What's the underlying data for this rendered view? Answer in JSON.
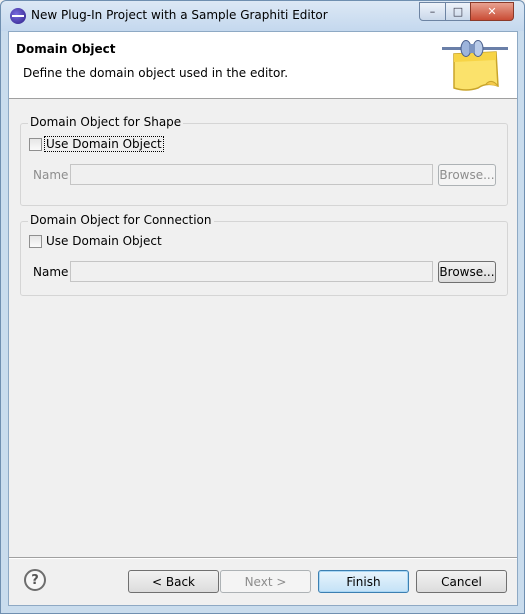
{
  "window": {
    "title": "New Plug-In Project with a Sample Graphiti Editor",
    "controls": {
      "minimize": "–",
      "maximize": "□",
      "close": "✕"
    }
  },
  "header": {
    "title": "Domain Object",
    "description": "Define the domain object used in the editor.",
    "icon": "wizard-banner-icon"
  },
  "shape_group": {
    "legend": "Domain Object for Shape",
    "checkbox_label": "Use Domain Object",
    "checked": false,
    "name_label": "Name",
    "name_value": "",
    "browse_label": "Browse...",
    "enabled": false
  },
  "connection_group": {
    "legend": "Domain Object for Connection",
    "checkbox_label": "Use Domain Object",
    "checked": false,
    "name_label": "Name",
    "name_value": "",
    "browse_label": "Browse...",
    "enabled": true
  },
  "footer": {
    "help": "?",
    "back_label": "< Back",
    "next_label": "Next >",
    "finish_label": "Finish",
    "cancel_label": "Cancel"
  }
}
